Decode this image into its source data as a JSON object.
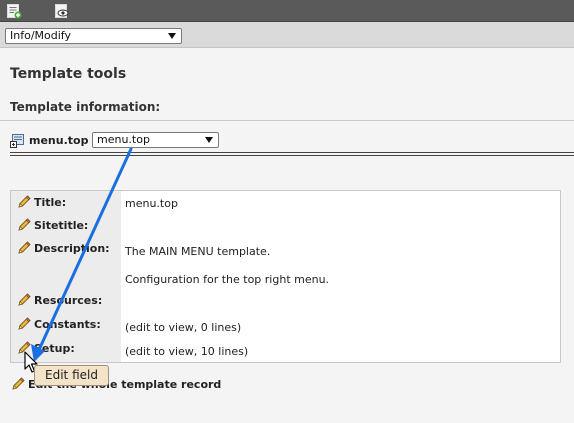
{
  "toolbar": {
    "icons": [
      "new-record-icon",
      "view-page-icon"
    ]
  },
  "function_menu": {
    "selected": "Info/Modify"
  },
  "header": {
    "title": "Template tools",
    "subtitle": "Template information:"
  },
  "template": {
    "name": "menu.top",
    "select_value": "menu.top"
  },
  "fields": [
    {
      "label": "Title:",
      "value": "menu.top"
    },
    {
      "label": "Sitetitle:",
      "value": ""
    },
    {
      "label": "Description:",
      "value": "The MAIN MENU template.",
      "value2": "Configuration for the top right menu."
    },
    {
      "label": "Resources:",
      "value": ""
    },
    {
      "label": "Constants:",
      "value": "(edit to view, 0 lines)"
    },
    {
      "label": "Setup:",
      "value": "(edit to view, 10 lines)"
    }
  ],
  "edit_whole": {
    "label": "Edit the whole template record"
  },
  "tooltip": {
    "text": "Edit field"
  },
  "colors": {
    "annotation_arrow": "#1a6fe0",
    "tooltip_bg": "#f3e3c8",
    "pencil": "#e8b83a"
  }
}
